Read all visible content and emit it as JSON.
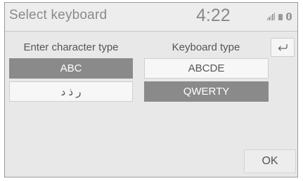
{
  "header": {
    "title": "Select keyboard",
    "time": "4:22"
  },
  "character_type": {
    "label": "Enter character type",
    "options": [
      "ABC",
      "ر ذ د"
    ],
    "selected": "ABC"
  },
  "keyboard_type": {
    "label": "Keyboard type",
    "options": [
      "ABCDE",
      "QWERTY"
    ],
    "selected": "QWERTY"
  },
  "buttons": {
    "back_icon": "return-arrow-icon",
    "ok_label": "OK"
  },
  "status_icons": [
    "signal-strength-icon",
    "phone-icon",
    "bluetooth-icon"
  ],
  "colors": {
    "screen_background": "#e8e8e8",
    "selected_option": "#8a8a8a",
    "option_background": "#f7f7f7"
  }
}
